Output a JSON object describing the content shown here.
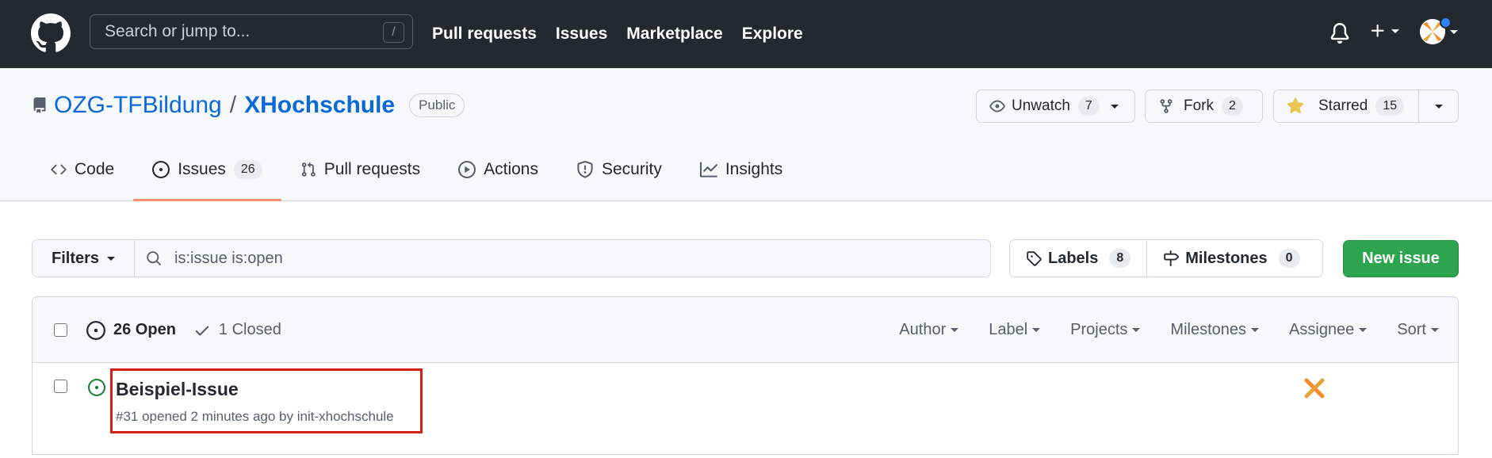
{
  "header": {
    "search_placeholder": "Search or jump to...",
    "search_shortcut": "/",
    "nav": [
      "Pull requests",
      "Issues",
      "Marketplace",
      "Explore"
    ]
  },
  "repo": {
    "owner": "OZG-TFBildung",
    "separator": "/",
    "name": "XHochschule",
    "visibility": "Public",
    "unwatch_label": "Unwatch",
    "watch_count": "7",
    "fork_label": "Fork",
    "fork_count": "2",
    "starred_label": "Starred",
    "star_count": "15"
  },
  "tabs": [
    {
      "label": "Code",
      "icon": "code-icon"
    },
    {
      "label": "Issues",
      "icon": "issue-opened-icon",
      "count": "26",
      "active": true
    },
    {
      "label": "Pull requests",
      "icon": "git-pull-request-icon"
    },
    {
      "label": "Actions",
      "icon": "play-icon"
    },
    {
      "label": "Security",
      "icon": "shield-icon"
    },
    {
      "label": "Insights",
      "icon": "graph-icon"
    }
  ],
  "filters": {
    "filters_label": "Filters",
    "search_value": "is:issue is:open",
    "labels_label": "Labels",
    "labels_count": "8",
    "milestones_label": "Milestones",
    "milestones_count": "0",
    "new_issue_label": "New issue"
  },
  "issues_header": {
    "open_label": "26 Open",
    "closed_label": "1 Closed",
    "sorts": [
      "Author",
      "Label",
      "Projects",
      "Milestones",
      "Assignee",
      "Sort"
    ]
  },
  "issues": [
    {
      "title": "Beispiel-Issue",
      "meta": "#31 opened 2 minutes ago by init-xhochschule",
      "state": "open"
    }
  ],
  "colors": {
    "header_bg": "#24292f",
    "link": "#0969da",
    "accent_tab": "#fd8c73",
    "primary_button": "#2da44e",
    "open_icon": "#1a7f37",
    "highlight_box": "#d91e18"
  }
}
